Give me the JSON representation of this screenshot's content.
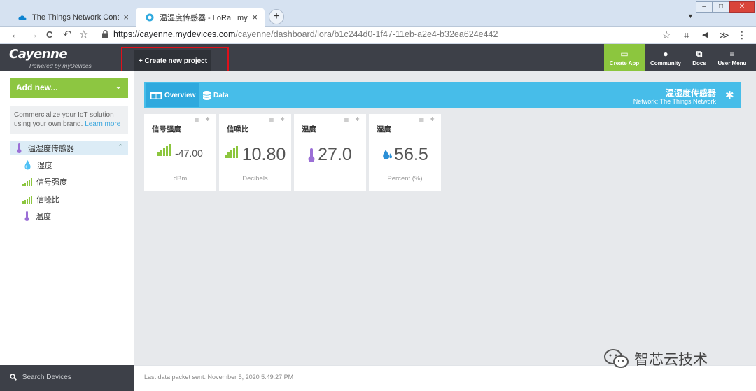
{
  "browser": {
    "tabs": [
      {
        "title": "The Things Network Console",
        "close": "×"
      },
      {
        "title": "温湿度传感器 - LoRa | myDevic",
        "close": "×"
      }
    ],
    "new_tab": "+",
    "tab_menu": "▼",
    "window_controls": {
      "minimize": "–",
      "maximize": "□",
      "close": "✕"
    },
    "nav": {
      "back": "←",
      "forward": "→",
      "reload": "C",
      "undo": "↶",
      "bookmark": "☆"
    },
    "url_host": "https://cayenne.mydevices.com",
    "url_path": "/cayenne/dashboard/lora/b1c244d0-1f47-11eb-a2e4-b32ea624e442",
    "right_icons": {
      "star": "☆",
      "crop": "⌗",
      "mute": "◀",
      "ext": "≫",
      "menu": "⋮"
    }
  },
  "header": {
    "logo": "Cayenne",
    "logo_sub": "Powered by myDevices",
    "create_project": "+ Create new project",
    "items": [
      {
        "label": "Create App",
        "icon": "▭"
      },
      {
        "label": "Community",
        "icon": "●"
      },
      {
        "label": "Docs",
        "icon": "⧉"
      },
      {
        "label": "User Menu",
        "icon": "≡"
      }
    ]
  },
  "sidebar": {
    "add_new": "Add new...",
    "add_new_chevron": "⌄",
    "promo_text": "Commercialize your IoT solution using your own brand.",
    "promo_link": "Learn more",
    "device": "温湿度传感器",
    "device_chevron": "⌃",
    "widgets": [
      "湿度",
      "信号强度",
      "信噪比",
      "温度"
    ],
    "search": "Search Devices",
    "search_icon": "search-icon"
  },
  "dashboard": {
    "tab_overview": "Overview",
    "tab_data": "Data",
    "device_name": "温湿度传感器",
    "network": "Network: The Things Network",
    "gear": "✱",
    "cards": [
      {
        "title": "信号强度",
        "value": "-47.00",
        "unit": "dBm",
        "icon": "signal-icon"
      },
      {
        "title": "信噪比",
        "value": "10.80",
        "unit": "Decibels",
        "icon": "signal-icon"
      },
      {
        "title": "温度",
        "value": "27.0",
        "unit": "",
        "icon": "thermometer-icon"
      },
      {
        "title": "湿度",
        "value": "56.5",
        "unit": "Percent (%)",
        "icon": "droplet-icon"
      }
    ],
    "card_tools": "▦ ✱"
  },
  "footer": {
    "last_packet": "Last data packet sent: November 5, 2020 5:49:27 PM"
  },
  "watermark": "智芯云技术",
  "colors": {
    "green": "#8cc63e",
    "blue": "#47bde9",
    "dark": "#3d4048",
    "highlight": "#e0111b"
  }
}
